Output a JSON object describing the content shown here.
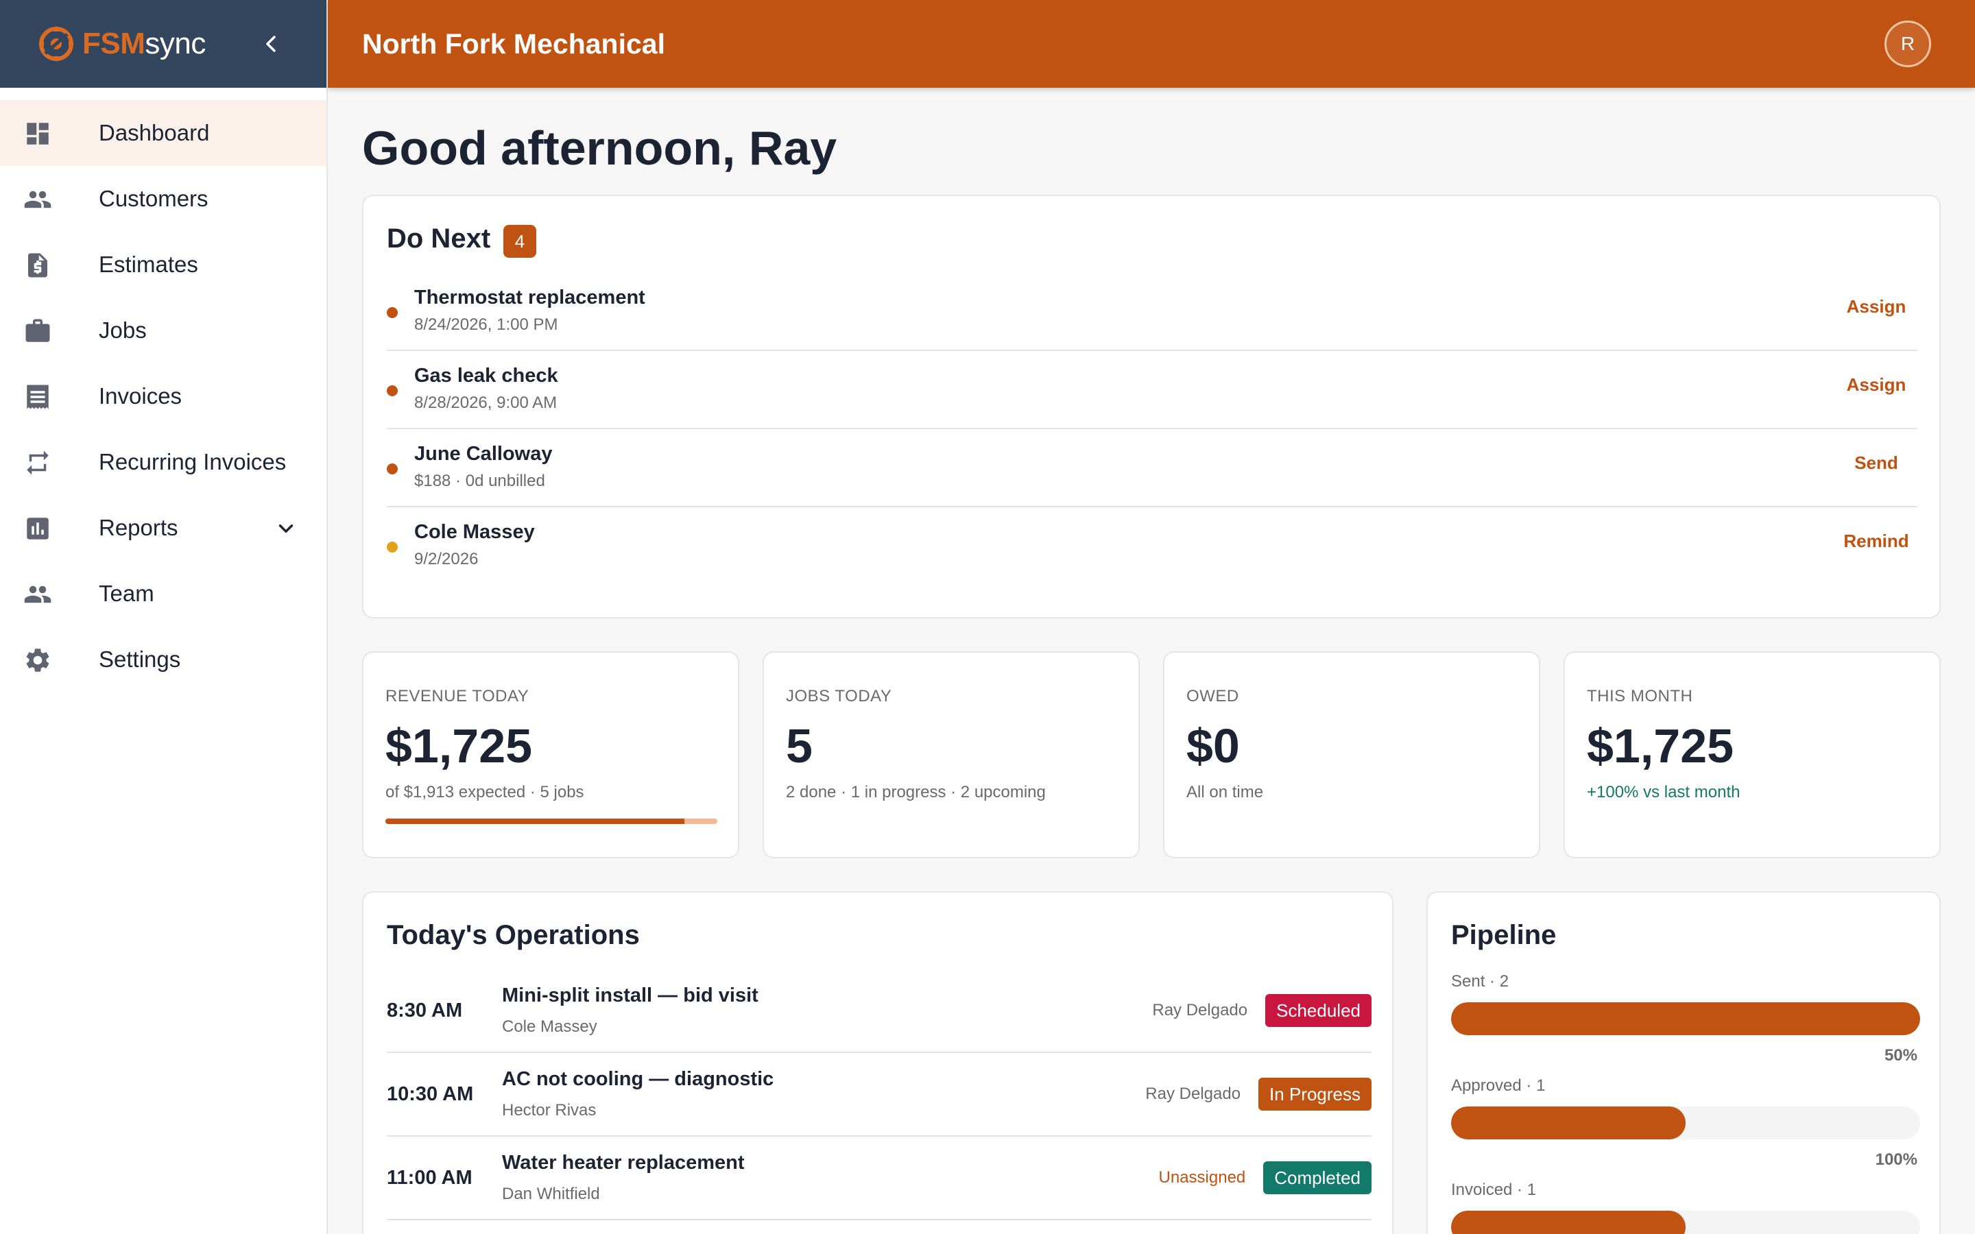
{
  "brand": {
    "fsm": "FSM",
    "sync": "sync"
  },
  "nav": {
    "items": [
      {
        "label": "Dashboard",
        "icon": "dashboard-icon"
      },
      {
        "label": "Customers",
        "icon": "people-icon"
      },
      {
        "label": "Estimates",
        "icon": "estimate-document-icon"
      },
      {
        "label": "Jobs",
        "icon": "briefcase-icon"
      },
      {
        "label": "Invoices",
        "icon": "receipt-icon"
      },
      {
        "label": "Recurring Invoices",
        "icon": "repeat-icon"
      },
      {
        "label": "Reports",
        "icon": "bar-chart-icon"
      },
      {
        "label": "Team",
        "icon": "team-icon"
      },
      {
        "label": "Settings",
        "icon": "gear-icon"
      }
    ],
    "active": "Dashboard"
  },
  "header": {
    "company": "North Fork Mechanical",
    "avatar_initial": "R"
  },
  "greeting": "Good afternoon, Ray",
  "do_next": {
    "title": "Do Next",
    "count": "4",
    "items": [
      {
        "title": "Thermostat replacement",
        "sub": "8/24/2026, 1:00 PM",
        "action": "Assign",
        "dot_color": "#c05312"
      },
      {
        "title": "Gas leak check",
        "sub": "8/28/2026, 9:00 AM",
        "action": "Assign",
        "dot_color": "#c05312"
      },
      {
        "title": "June Calloway",
        "sub": "$188 · 0d unbilled",
        "action": "Send",
        "dot_color": "#c05312"
      },
      {
        "title": "Cole Massey",
        "sub": "9/2/2026",
        "action": "Remind",
        "dot_color": "#e0a21a"
      }
    ]
  },
  "stats": [
    {
      "label": "REVENUE TODAY",
      "value": "$1,725",
      "sub": "of $1,913 expected · 5 jobs",
      "progress": 0.9
    },
    {
      "label": "JOBS TODAY",
      "value": "5",
      "sub": "2 done · 1 in progress · 2 upcoming"
    },
    {
      "label": "OWED",
      "value": "$0",
      "sub": "All on time"
    },
    {
      "label": "THIS MONTH",
      "value": "$1,725",
      "sub": "+100% vs last month",
      "sub_color": "#127a5e"
    }
  ],
  "operations": {
    "title": "Today's Operations",
    "rows": [
      {
        "time": "8:30 AM",
        "title": "Mini-split install — bid visit",
        "customer": "Cole Massey",
        "tech": "Ray Delgado",
        "status": "Scheduled",
        "status_color": "#c8163e"
      },
      {
        "time": "10:30 AM",
        "title": "AC not cooling — diagnostic",
        "customer": "Hector Rivas",
        "tech": "Ray Delgado",
        "status": "In Progress",
        "status_color": "#c05312"
      },
      {
        "time": "11:00 AM",
        "title": "Water heater replacement",
        "customer": "Dan Whitfield",
        "tech": "Unassigned",
        "status": "Completed",
        "status_color": "#12796b"
      }
    ]
  },
  "pipeline": {
    "title": "Pipeline",
    "stages": [
      {
        "label": "Sent · 2",
        "pct": "50%",
        "fill": 1.0
      },
      {
        "label": "Approved · 1",
        "pct": "100%",
        "fill": 0.5
      },
      {
        "label": "Invoiced · 1",
        "fill": 0.5
      }
    ]
  },
  "colors": {
    "accent": "#c05312",
    "sidebar_header": "#34465d",
    "active_nav_bg": "#fbf1ea"
  }
}
